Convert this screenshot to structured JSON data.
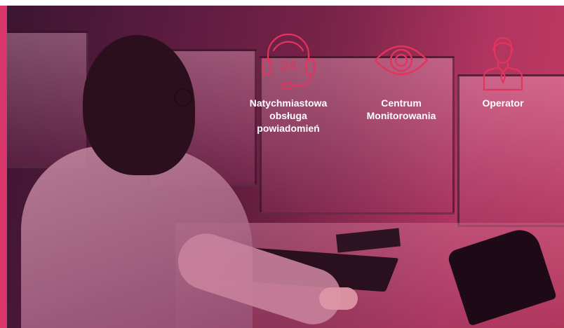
{
  "features": [
    {
      "icon": "headset-24-icon",
      "label": "Natychmiastowa\nobsługa\npowiadomień",
      "icon_text": "24"
    },
    {
      "icon": "eye-icon",
      "label": "Centrum\nMonitorowania"
    },
    {
      "icon": "operator-person-icon",
      "label": "Operator"
    }
  ],
  "colors": {
    "accent": "#e3335f",
    "overlay": "#7a2448",
    "text": "#ffffff"
  }
}
